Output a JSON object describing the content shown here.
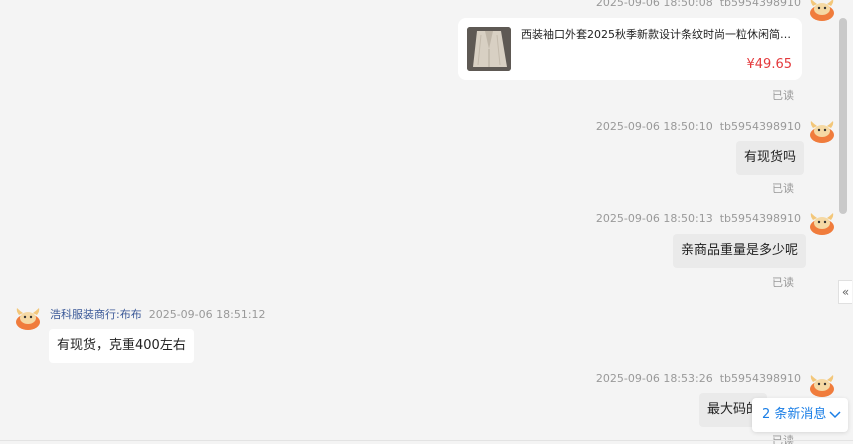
{
  "messages": {
    "m1": {
      "time": "2025-09-06 18:50:08",
      "sender": "tb5954398910"
    },
    "product": {
      "title": "西装袖口外套2025秋季新款设计条纹时尚一粒休闲简约...",
      "price": "¥49.65",
      "read": "已读"
    },
    "m2": {
      "time": "2025-09-06 18:50:10",
      "sender": "tb5954398910",
      "text": "有现货吗",
      "read": "已读"
    },
    "m3": {
      "time": "2025-09-06 18:50:13",
      "sender": "tb5954398910",
      "text": "亲商品重量是多少呢",
      "read": "已读"
    },
    "m4": {
      "sender": "浩科服装商行:布布",
      "time": "2025-09-06 18:51:12",
      "text": "有现货，克重400左右"
    },
    "m5": {
      "time": "2025-09-06 18:53:26",
      "sender": "tb5954398910",
      "text": "最大码的",
      "read": "已读"
    }
  },
  "new_messages": {
    "label": "2 条新消息"
  },
  "icons": {
    "avatar": "bull-avatar-icon",
    "collapse": "double-chevron-left-icon",
    "chevron": "chevron-down-icon"
  },
  "colors": {
    "accent": "#1a7ee6",
    "price": "#e4393c",
    "seller_name": "#3b5998",
    "avatar": "#f07c3c"
  }
}
